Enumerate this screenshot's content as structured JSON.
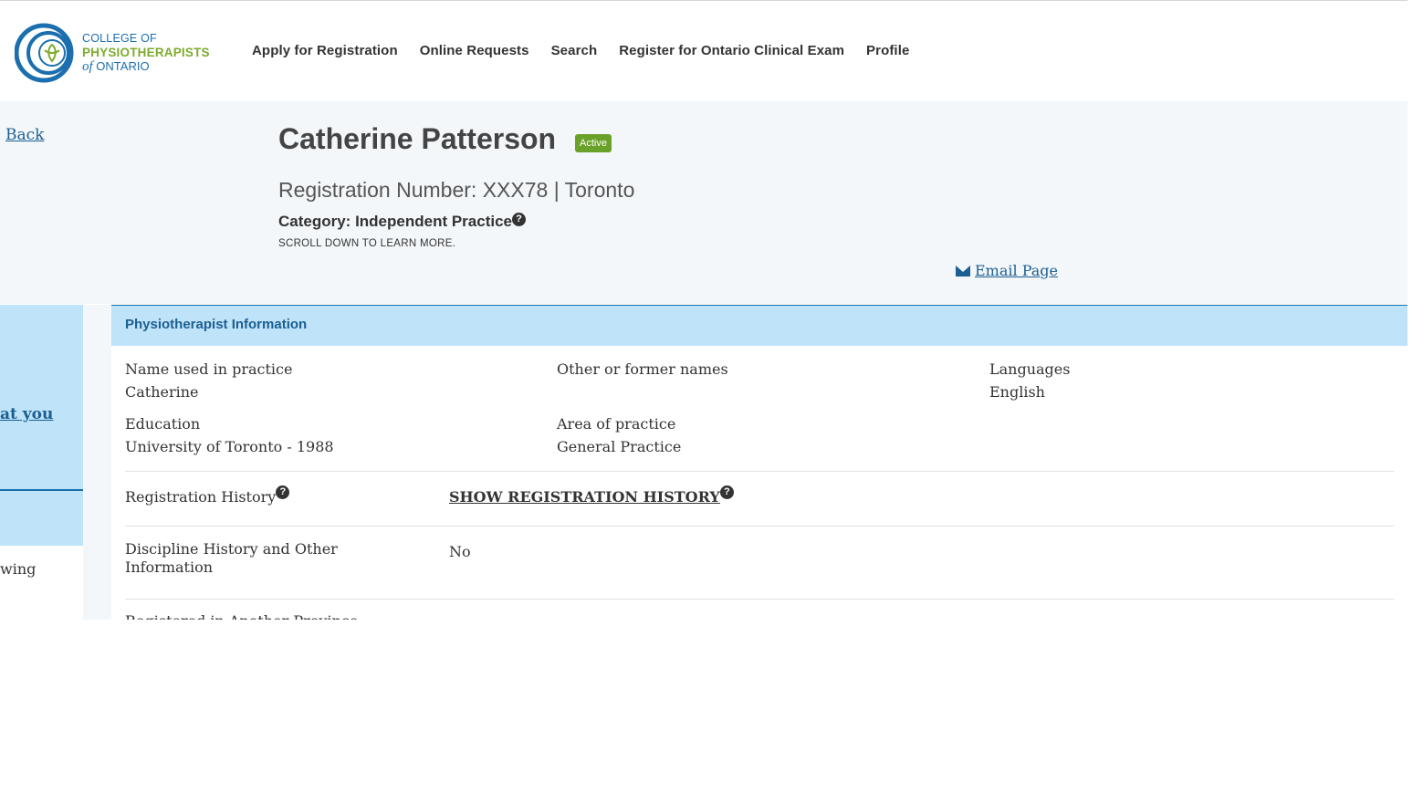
{
  "header": {
    "logo": {
      "line1": "COLLEGE OF",
      "line2": "PHYSIOTHERAPISTS",
      "line3_of": "of",
      "line3_rest": "ONTARIO"
    },
    "nav": [
      "Apply for Registration",
      "Online Requests",
      "Search",
      "Register for Ontario Clinical Exam",
      "Profile"
    ]
  },
  "profile": {
    "back_label": "Back",
    "name": "Catherine Patterson",
    "status": "Active",
    "registration_line": "Registration Number: XXX78 | Toronto",
    "category": "Category: Independent Practice",
    "scroll_note": "SCROLL DOWN TO LEARN MORE.",
    "email_label": "Email Page"
  },
  "sidebar": {
    "link_fragment": "at you",
    "text_fragment": "wing"
  },
  "panel": {
    "title": "Physiotherapist Information",
    "fields": {
      "name_label": "Name used in practice",
      "name_value": "Catherine",
      "former_label": "Other or former names",
      "former_value": "",
      "languages_label": "Languages",
      "languages_value": "English",
      "education_label": "Education",
      "education_value": "University of Toronto - 1988",
      "area_label": "Area of practice",
      "area_value": "General Practice"
    },
    "registration_history_label": "Registration History",
    "show_history_label": "SHOW REGISTRATION HISTORY",
    "discipline_label": "Discipline History and Other Information",
    "discipline_value": "No",
    "next_row_fragment": "Registered in Another Province"
  },
  "colors": {
    "brand_blue": "#1b6fae",
    "brand_green": "#7dab2f",
    "badge_green": "#6aa12a",
    "panel_blue": "#bfe3f8",
    "hero_bg": "#f3f7fa"
  }
}
